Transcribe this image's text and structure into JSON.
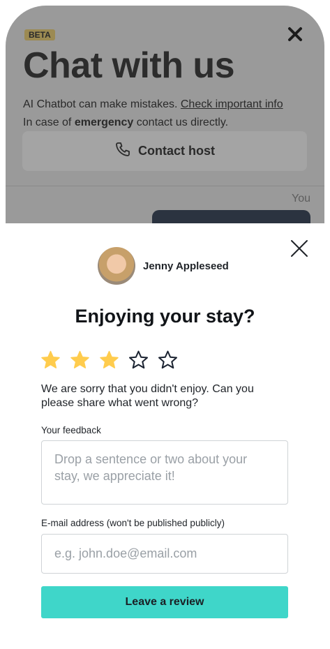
{
  "chat": {
    "badge": "BETA",
    "title": "Chat with us",
    "disclaimer_prefix": "AI Chatbot can make mistakes. ",
    "disclaimer_link": "Check important info",
    "emergency_prefix": "In case of ",
    "emergency_bold": "emergency",
    "emergency_suffix": " contact us directly.",
    "contact_button": "Contact host",
    "sender_label": "You"
  },
  "review": {
    "host_name": "Jenny Appleseed",
    "question": "Enjoying your stay?",
    "rating": 3,
    "max_rating": 5,
    "star_filled_color": "#FFCC4D",
    "star_empty_color": "#1a2230",
    "sorry_message": "We are sorry that you didn't enjoy. Can you please share what went wrong?",
    "feedback_label": "Your feedback",
    "feedback_placeholder": "Drop a sentence or two about your stay, we appreciate it!",
    "email_label": "E-mail address (won't be published publicly)",
    "email_placeholder": "e.g. john.doe@email.com",
    "submit_button": "Leave a review",
    "accent_color": "#3FD6C9"
  },
  "icons": {
    "close": "close-icon",
    "phone": "phone-icon",
    "star": "star-icon"
  }
}
